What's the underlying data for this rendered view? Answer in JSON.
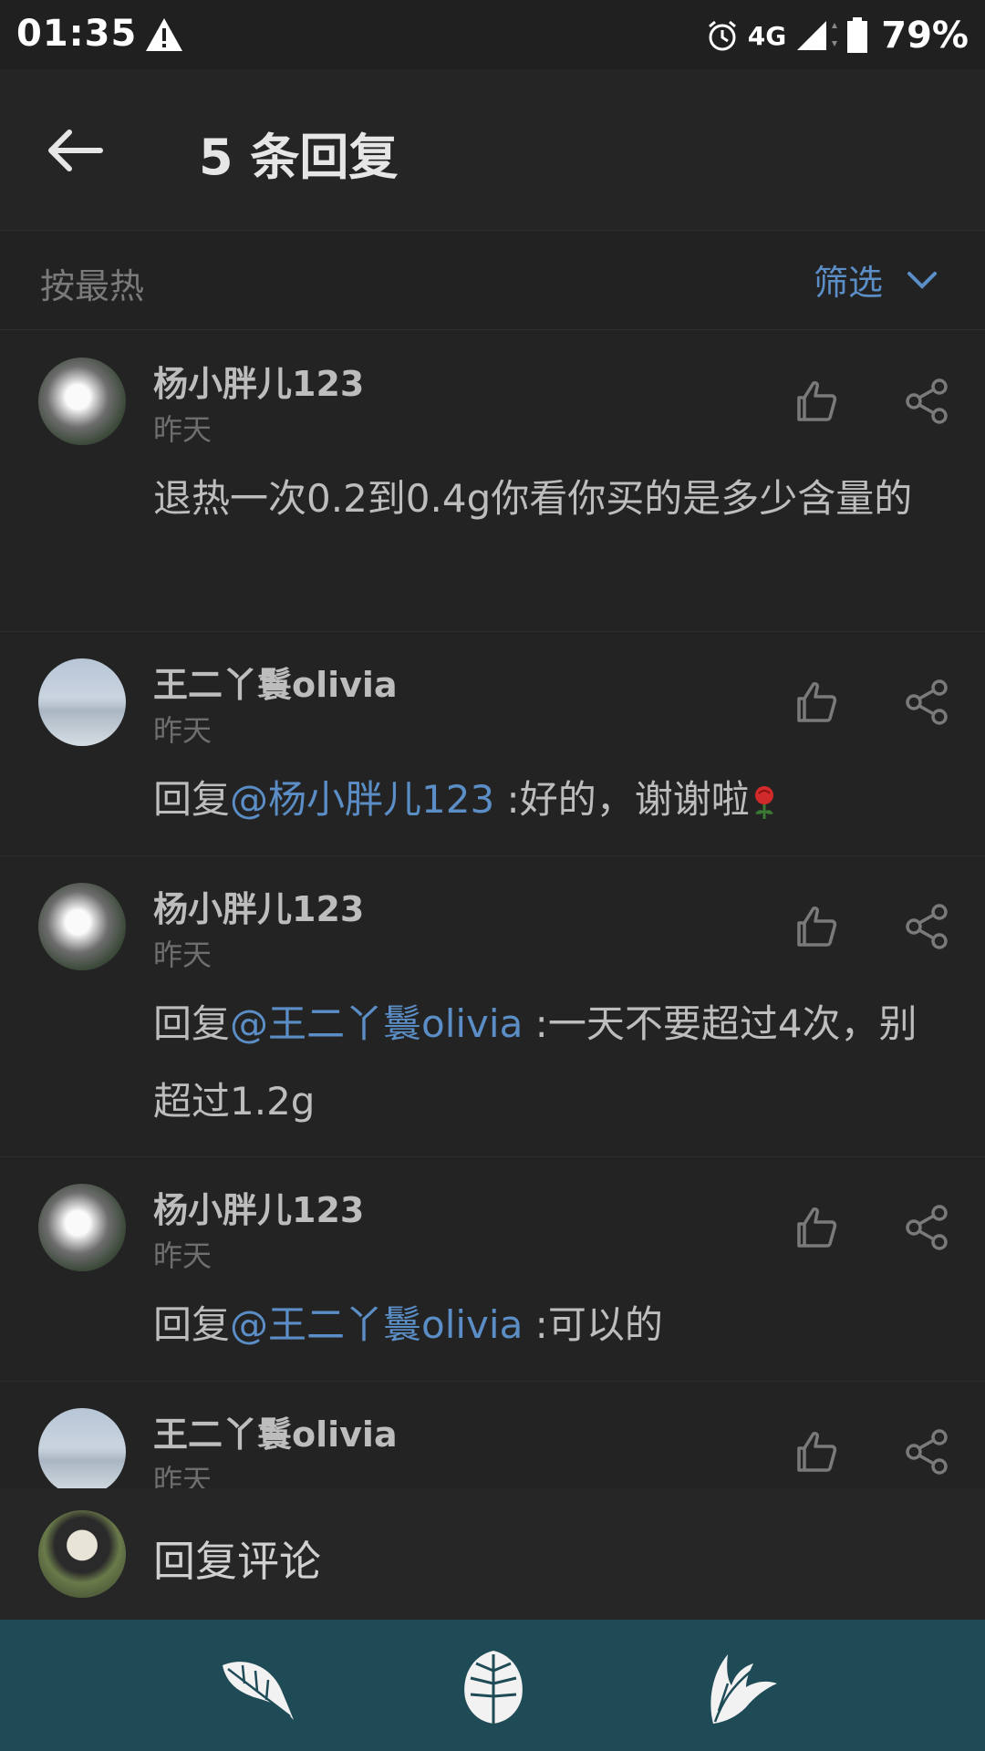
{
  "status_bar": {
    "time": "01:35",
    "network": "4G",
    "battery": "79%",
    "icons": [
      "warning-icon",
      "alarm-icon",
      "signal-icon",
      "battery-icon"
    ]
  },
  "header": {
    "title": "5 条回复",
    "back_icon": "arrow-left-icon"
  },
  "sort_bar": {
    "sort_label": "按最热",
    "filter_label": "筛选"
  },
  "comments": [
    {
      "user": "杨小胖儿123",
      "time": "昨天",
      "prefix": "",
      "mention": "",
      "text": "退热一次0.2到0.4g你看你买的是多少含量的",
      "avatar": "lily"
    },
    {
      "user": "王二丫鬟olivia",
      "time": "昨天",
      "prefix": "回复",
      "mention": "@杨小胖儿123",
      "text": " :好的，谢谢啦",
      "avatar": "sky"
    },
    {
      "user": "杨小胖儿123",
      "time": "昨天",
      "prefix": "回复",
      "mention": "@王二丫鬟olivia",
      "text": " :一天不要超过4次，别超过1.2g",
      "avatar": "lily"
    },
    {
      "user": "杨小胖儿123",
      "time": "昨天",
      "prefix": "回复",
      "mention": "@王二丫鬟olivia",
      "text": " :可以的",
      "avatar": "lily"
    },
    {
      "user": "王二丫鬟olivia",
      "time": "昨天",
      "prefix": "",
      "mention": "",
      "text": "",
      "avatar": "sky"
    }
  ],
  "reply_bar": {
    "placeholder": "回复评论"
  },
  "bottom_nav": {
    "icons": [
      "feather-leaf-icon",
      "monstera-leaf-icon",
      "palm-leaf-icon"
    ]
  },
  "colors": {
    "background": "#232323",
    "accent": "#5b8ec6",
    "bottom_nav": "#1f4b57"
  }
}
